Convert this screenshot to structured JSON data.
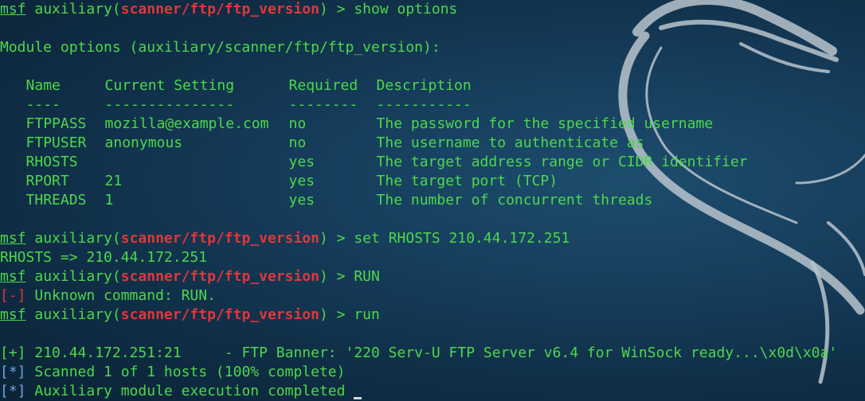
{
  "prompt": {
    "msf": "msf",
    "word": " auxiliary(",
    "module": "scanner/ftp/ftp_version",
    "close": ") > "
  },
  "commands": {
    "show_options": "show options",
    "set_rhosts": "set RHOSTS 210.44.172.251",
    "run_upper": "RUN",
    "run_lower": "run"
  },
  "module_options_header": "Module options (auxiliary/scanner/ftp/ftp_version):",
  "options_table": {
    "headers": [
      "Name",
      "Current Setting",
      "Required",
      "Description"
    ],
    "underlines": [
      "----",
      "---------------",
      "--------",
      "-----------"
    ],
    "rows": [
      [
        "FTPPASS",
        "mozilla@example.com",
        "no",
        "The password for the specified username"
      ],
      [
        "FTPUSER",
        "anonymous",
        "no",
        "The username to authenticate as"
      ],
      [
        "RHOSTS",
        "",
        "yes",
        "The target address range or CIDR identifier"
      ],
      [
        "RPORT",
        "21",
        "yes",
        "The target port (TCP)"
      ],
      [
        "THREADS",
        "1",
        "yes",
        "The number of concurrent threads"
      ]
    ]
  },
  "outputs": {
    "rhosts_set": "RHOSTS => 210.44.172.251",
    "err_tag": "[-]",
    "err_text": " Unknown command: RUN.",
    "good_tag": "[+]",
    "good_text": " 210.44.172.251:21     - FTP Banner: '220 Serv-U FTP Server v6.4 for WinSock ready...\\x0d\\x0a'",
    "info_tag": "[*]",
    "scanned_text": " Scanned 1 of 1 hosts (100% complete)",
    "completed_text": " Auxiliary module execution completed "
  },
  "colors": {
    "text": "#4dd84a",
    "module": "#e0373a",
    "info": "#6da7e0",
    "background": "#163d5c"
  },
  "icons": {
    "background_logo": "kali-dragon-icon"
  }
}
